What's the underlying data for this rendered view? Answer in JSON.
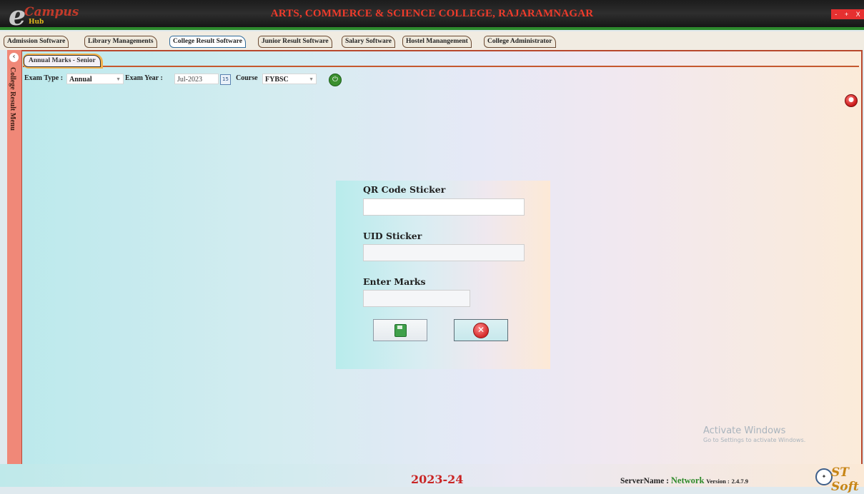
{
  "app": {
    "logo_e": "e",
    "logo_campus": "Campus",
    "logo_hub": "Hub",
    "title": "ARTS, COMMERCE & SCIENCE COLLEGE, RAJARAMNAGAR",
    "window_controls": {
      "minimize": "-",
      "maximize": "+",
      "close": "X"
    }
  },
  "main_tabs": [
    {
      "label": "Admission Software"
    },
    {
      "label": "Library Managements"
    },
    {
      "label": "College Result Software",
      "active": true
    },
    {
      "label": "Junior Result Software"
    },
    {
      "label": "Salary Software"
    },
    {
      "label": "Hostel Manangement"
    },
    {
      "label": "College Administrator"
    }
  ],
  "sidebar": {
    "label": "College Result Menu",
    "collapse_icon": "chevron-left-icon"
  },
  "sub_tab": {
    "label": "Annual Marks - Senior"
  },
  "filters": {
    "exam_type_label": "Exam Type :",
    "exam_type_value": "Annual",
    "exam_year_label": "Exam Year :",
    "exam_year_value": "Jul-2023",
    "calendar_icon_text": "15",
    "course_label": "Course",
    "course_value": "FYBSC"
  },
  "panel": {
    "qr_label": "QR Code Sticker",
    "qr_value": "",
    "uid_label": "UID Sticker",
    "uid_value": "",
    "marks_label": "Enter Marks",
    "marks_value": "",
    "save_icon": "save-icon",
    "cancel_icon": "cancel-icon"
  },
  "watermark": {
    "title": "Activate Windows",
    "subtitle": "Go to Settings to activate Windows."
  },
  "status": {
    "year": "2023-24",
    "server_label": "ServerName :",
    "server_value": "Network",
    "version_label": "Version :",
    "version_value": "2.4.7.9",
    "vendor_logo_text": "ST Soft"
  },
  "colors": {
    "title_red": "#ee3b2b",
    "frame_border": "#b8482d",
    "sidebar": "#f08878",
    "network_green": "#2f8a2b",
    "year_red": "#c92525"
  }
}
